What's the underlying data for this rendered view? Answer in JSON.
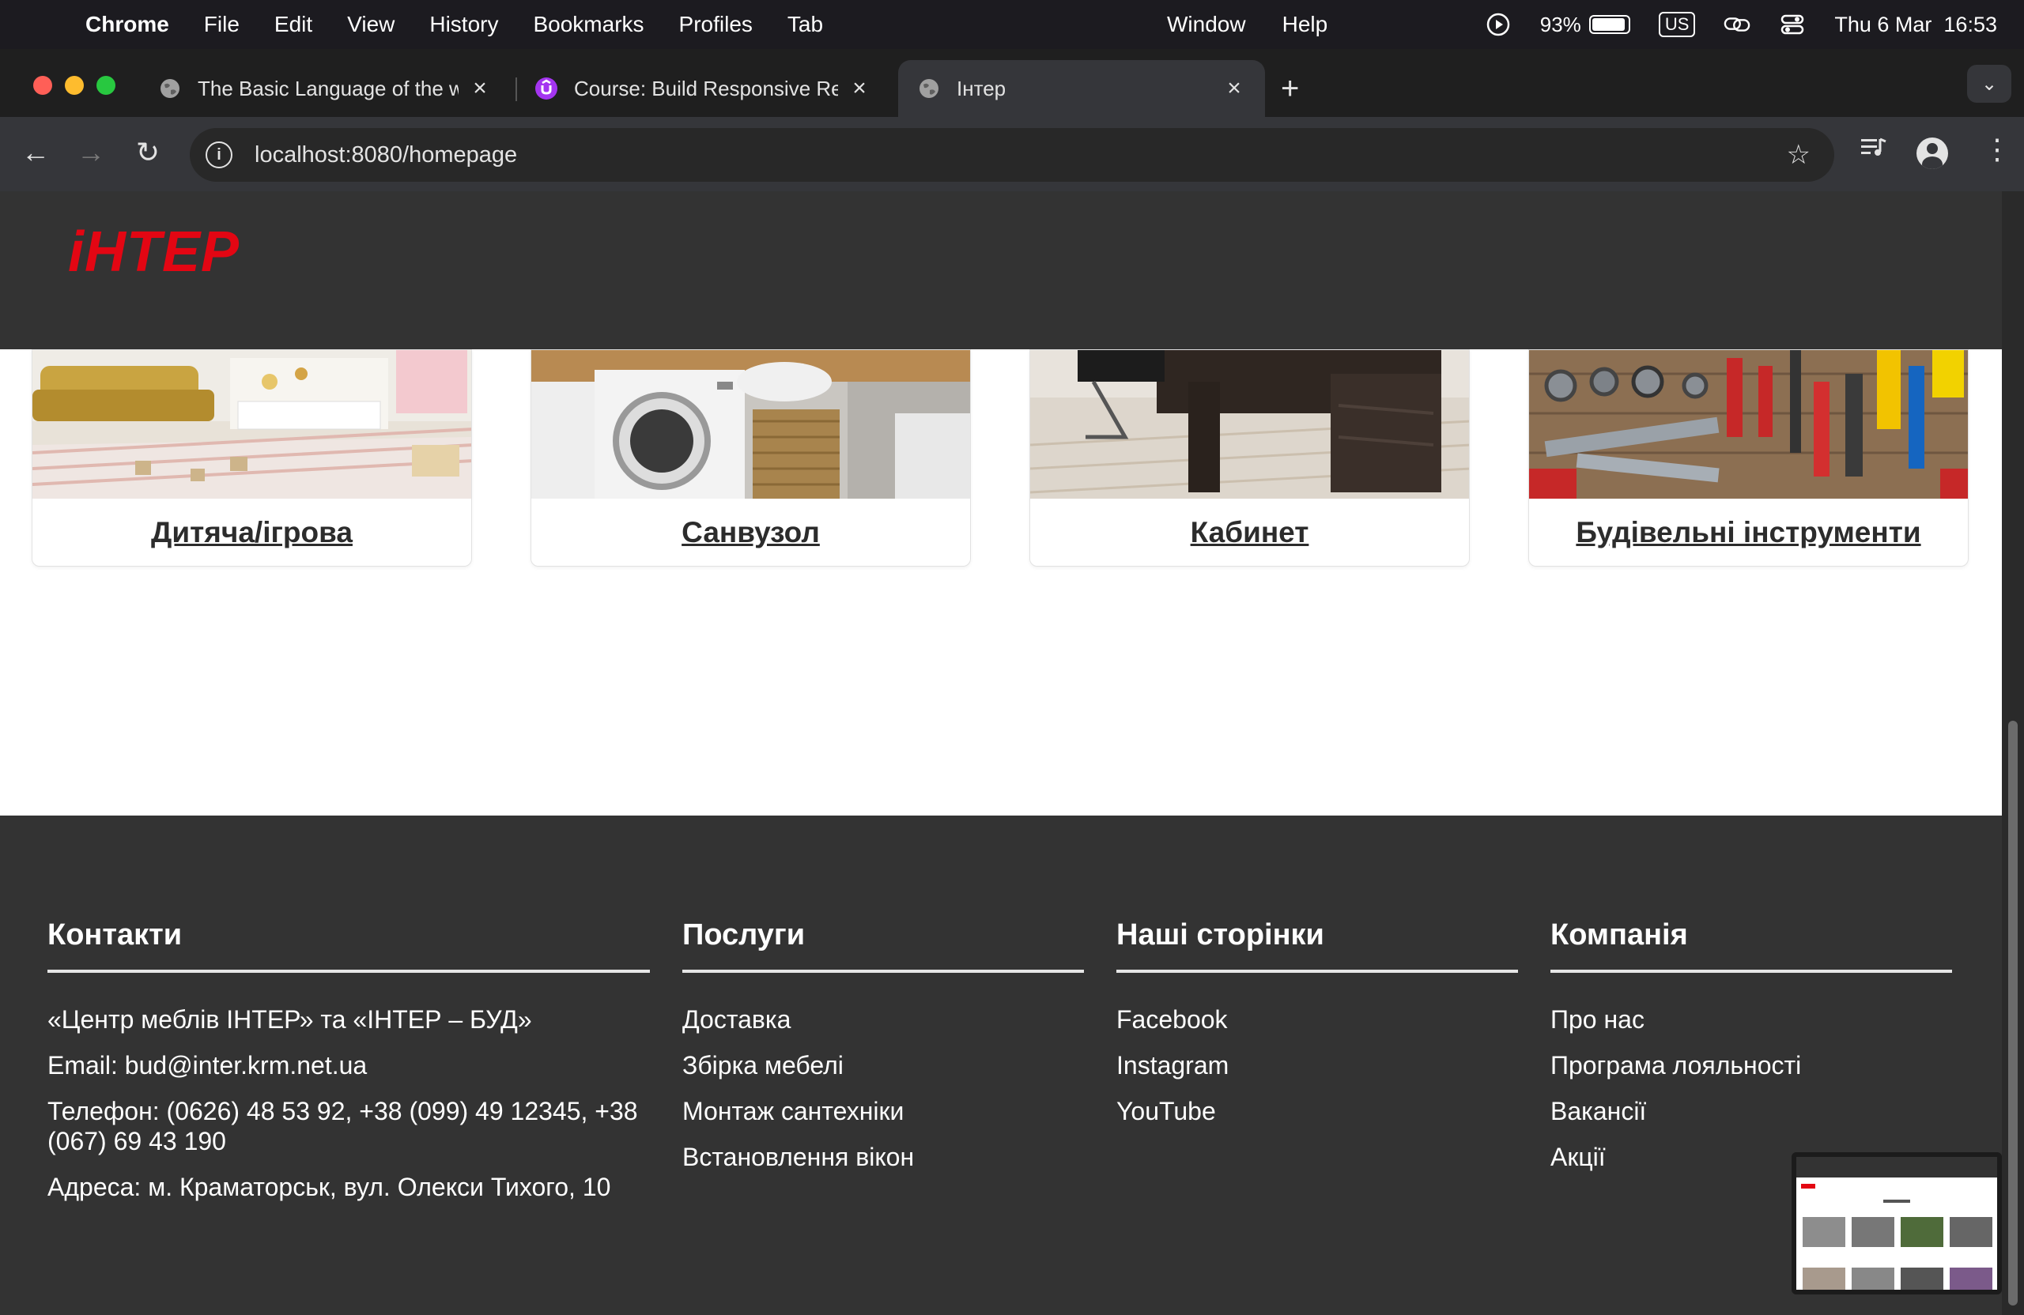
{
  "menubar": {
    "app": "Chrome",
    "items": [
      "File",
      "Edit",
      "View",
      "History",
      "Bookmarks",
      "Profiles",
      "Tab"
    ],
    "right_items": [
      "Window",
      "Help"
    ],
    "battery": "93%",
    "battery_level": 0.93,
    "input_source": "US",
    "datetime": "Thu 6 Mar  16:53"
  },
  "browser": {
    "tabs": [
      {
        "title": "The Basic Language of the web",
        "icon": "globe-icon"
      },
      {
        "title": "Course: Build Responsive Real",
        "icon": "udemy-icon"
      },
      {
        "title": "Інтер",
        "icon": "globe-icon"
      }
    ],
    "url": "localhost:8080/homepage"
  },
  "site": {
    "logo": "іНТЕР",
    "categories": [
      {
        "label": "Дитяча/ігрова"
      },
      {
        "label": "Санвузол"
      },
      {
        "label": "Кабинет"
      },
      {
        "label": "Будівельні інструменти"
      }
    ]
  },
  "footer": {
    "contacts": {
      "title": "Контакти",
      "items": [
        "«Центр меблів ІНТЕР» та «ІНТЕР – БУД»",
        "Email: bud@inter.krm.net.ua",
        "Телефон: (0626) 48 53 92, +38 (099) 49 12345, +38 (067) 69 43 190",
        "Адреса: м. Краматорськ, вул. Олекси Тихого, 10"
      ]
    },
    "services": {
      "title": "Послуги",
      "items": [
        "Доставка",
        "Збірка мебелі",
        "Монтаж сантехніки",
        "Встановлення вікон"
      ]
    },
    "pages": {
      "title": "Наші сторінки",
      "items": [
        "Facebook",
        "Instagram",
        "YouTube"
      ]
    },
    "company": {
      "title": "Компанія",
      "items": [
        "Про нас",
        "Програма лояльності",
        "Вакансії",
        "Акції"
      ]
    }
  }
}
